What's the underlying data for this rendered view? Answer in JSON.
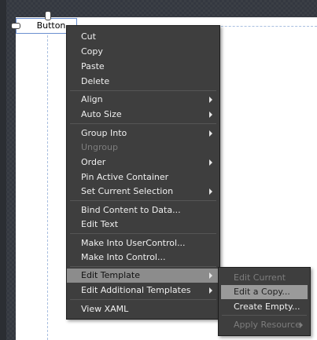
{
  "designer": {
    "selected_element_label": "Button"
  },
  "context_menu": {
    "items": [
      {
        "label": "Cut",
        "submenu": false,
        "disabled": false
      },
      {
        "label": "Copy",
        "submenu": false,
        "disabled": false
      },
      {
        "label": "Paste",
        "submenu": false,
        "disabled": false
      },
      {
        "label": "Delete",
        "submenu": false,
        "disabled": false
      },
      {
        "label": "Align",
        "submenu": true,
        "disabled": false
      },
      {
        "label": "Auto Size",
        "submenu": true,
        "disabled": false
      },
      {
        "label": "Group Into",
        "submenu": true,
        "disabled": false
      },
      {
        "label": "Ungroup",
        "submenu": false,
        "disabled": true
      },
      {
        "label": "Order",
        "submenu": true,
        "disabled": false
      },
      {
        "label": "Pin Active Container",
        "submenu": false,
        "disabled": false
      },
      {
        "label": "Set Current Selection",
        "submenu": true,
        "disabled": false
      },
      {
        "label": "Bind Content to Data...",
        "submenu": false,
        "disabled": false
      },
      {
        "label": "Edit Text",
        "submenu": false,
        "disabled": false
      },
      {
        "label": "Make Into UserControl...",
        "submenu": false,
        "disabled": false
      },
      {
        "label": "Make Into Control...",
        "submenu": false,
        "disabled": false
      },
      {
        "label": "Edit Template",
        "submenu": true,
        "disabled": false,
        "highlighted": true
      },
      {
        "label": "Edit Additional Templates",
        "submenu": true,
        "disabled": false
      },
      {
        "label": "View XAML",
        "submenu": false,
        "disabled": false
      }
    ]
  },
  "submenu": {
    "items": [
      {
        "label": "Edit Current",
        "disabled": true
      },
      {
        "label": "Edit a Copy...",
        "disabled": false,
        "highlighted": true
      },
      {
        "label": "Create Empty...",
        "disabled": false
      },
      {
        "label": "Apply Resource",
        "disabled": true,
        "submenu": true
      }
    ]
  },
  "colors": {
    "menu_bg": "#3e3e3e",
    "menu_highlight": "#8c8c8c",
    "menu_text": "#f0f0f0",
    "disabled_text": "#7d7d7d",
    "selection_border": "#6b8fd0"
  }
}
